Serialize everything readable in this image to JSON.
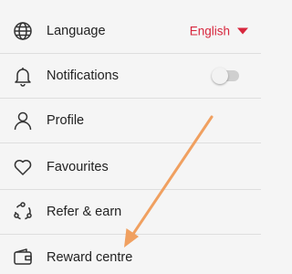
{
  "settings": {
    "items": [
      {
        "label": "Language",
        "icon": "globe-icon"
      },
      {
        "label": "Notifications",
        "icon": "bell-icon"
      },
      {
        "label": "Profile",
        "icon": "person-icon"
      },
      {
        "label": "Favourites",
        "icon": "heart-icon"
      },
      {
        "label": "Refer & earn",
        "icon": "share-icon"
      },
      {
        "label": "Reward centre",
        "icon": "wallet-icon"
      }
    ],
    "language_value": "English",
    "notifications_enabled": false
  },
  "annotation": {
    "arrow_color": "#f0a060"
  },
  "colors": {
    "accent": "#d7263d",
    "background": "#f5f5f5",
    "text": "#222222",
    "icon": "#333333"
  }
}
